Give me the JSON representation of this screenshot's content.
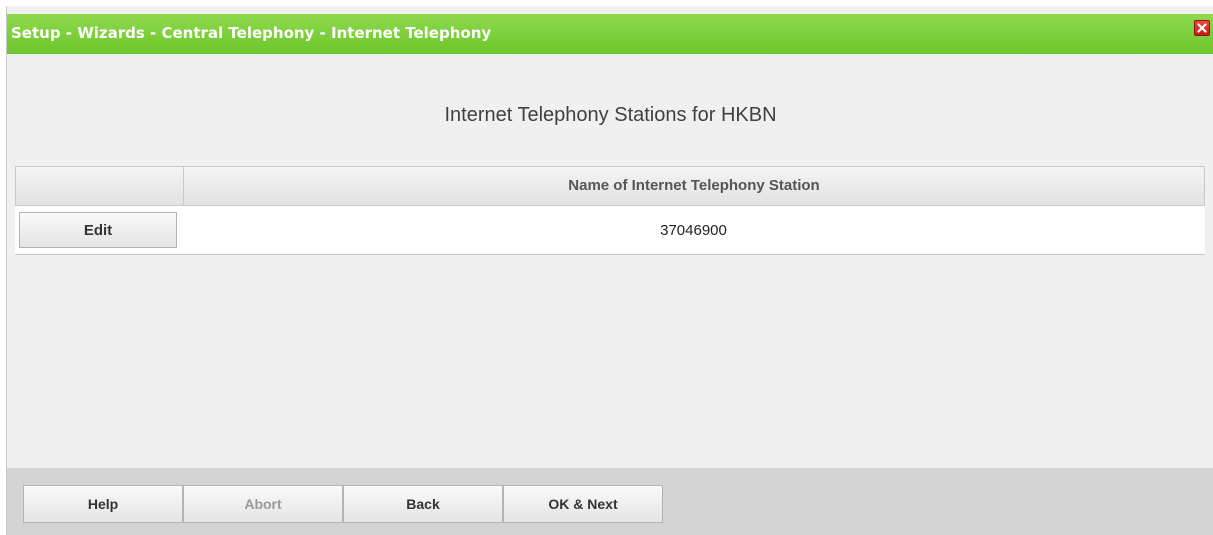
{
  "window": {
    "title": "Setup - Wizards - Central Telephony - Internet Telephony",
    "close_icon": "close-icon"
  },
  "main": {
    "heading": "Internet Telephony Stations for HKBN",
    "table": {
      "columns": [
        "",
        "Name of Internet Telephony Station"
      ],
      "rows": [
        {
          "action_label": "Edit",
          "station_name": "37046900"
        }
      ]
    }
  },
  "footer": {
    "buttons": [
      {
        "label": "Help",
        "enabled": true
      },
      {
        "label": "Abort",
        "enabled": false
      },
      {
        "label": "Back",
        "enabled": true
      },
      {
        "label": "OK & Next",
        "enabled": true
      }
    ]
  },
  "colors": {
    "titlebar_green": "#6cc62a",
    "close_red": "#d92b1d",
    "disabled_text": "#9a9a9a"
  }
}
